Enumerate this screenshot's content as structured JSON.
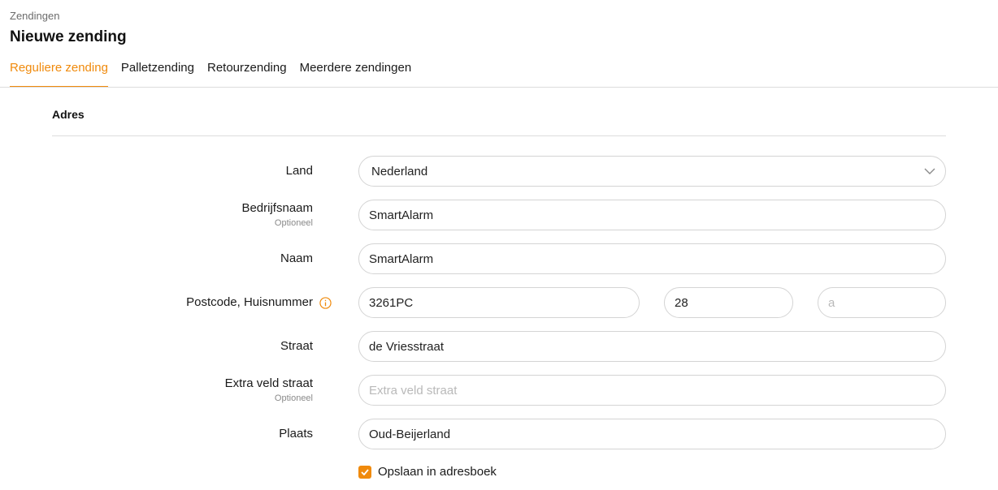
{
  "header": {
    "breadcrumb": "Zendingen",
    "title": "Nieuwe zending"
  },
  "tabs": [
    {
      "label": "Reguliere zending",
      "active": true
    },
    {
      "label": "Palletzending",
      "active": false
    },
    {
      "label": "Retourzending",
      "active": false
    },
    {
      "label": "Meerdere zendingen",
      "active": false
    }
  ],
  "section": {
    "title": "Adres"
  },
  "form": {
    "country": {
      "label": "Land",
      "value": "Nederland"
    },
    "company": {
      "label": "Bedrijfsnaam",
      "sub_label": "Optioneel",
      "value": "SmartAlarm"
    },
    "name": {
      "label": "Naam",
      "value": "SmartAlarm"
    },
    "postcode": {
      "label": "Postcode, Huisnummer",
      "postcode_value": "3261PC",
      "number_value": "28",
      "suffix_placeholder": "a"
    },
    "street": {
      "label": "Straat",
      "value": "de Vriesstraat"
    },
    "street_extra": {
      "label": "Extra veld straat",
      "sub_label": "Optioneel",
      "placeholder": "Extra veld straat"
    },
    "city": {
      "label": "Plaats",
      "value": "Oud-Beijerland"
    },
    "save_address": {
      "label": "Opslaan in adresboek",
      "checked": true
    }
  },
  "colors": {
    "accent": "#f08a0c",
    "border": "#d4d4d4",
    "divider": "#dddddd"
  },
  "icons": [
    "chevron-down-icon",
    "info-icon",
    "check-icon"
  ]
}
